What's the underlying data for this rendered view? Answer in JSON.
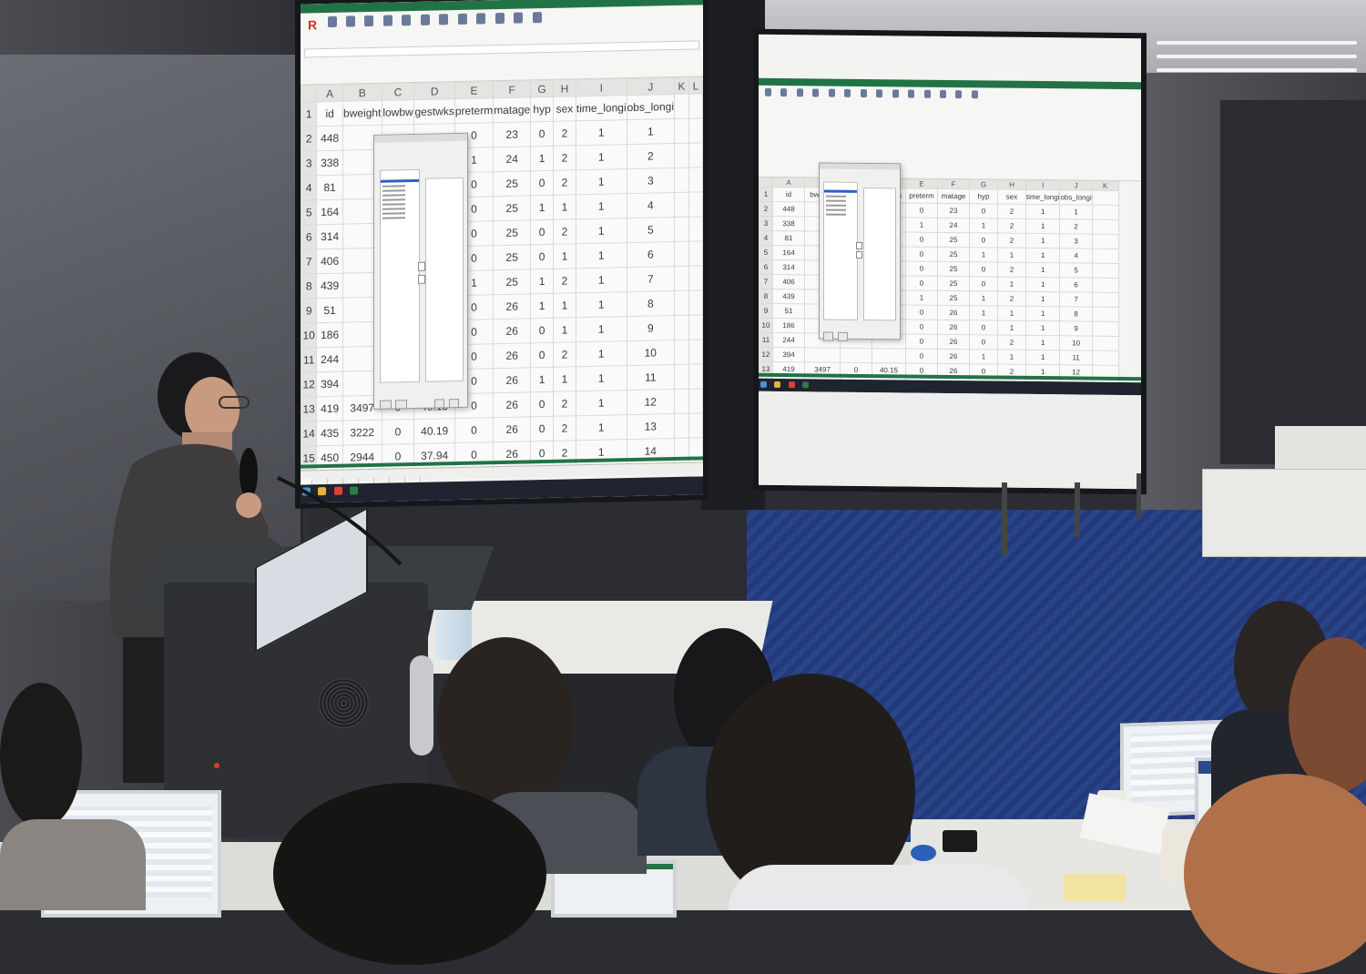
{
  "slide": {
    "app_logo": "R",
    "columns": [
      "A",
      "B",
      "C",
      "D",
      "E",
      "F",
      "G",
      "H",
      "I",
      "J",
      "K",
      "L"
    ],
    "headers": [
      "id",
      "bweight",
      "lowbw",
      "gestwks",
      "preterm",
      "matage",
      "hyp",
      "sex",
      "time_longi",
      "obs_longi"
    ],
    "rows": [
      {
        "n": "2",
        "id": "448",
        "bweight": "",
        "lowbw": "",
        "gestwks": "",
        "preterm": "0",
        "matage": "23",
        "hyp": "0",
        "sex": "2",
        "time": "1",
        "obs": "1"
      },
      {
        "n": "3",
        "id": "338",
        "bweight": "",
        "lowbw": "",
        "gestwks": "",
        "preterm": "1",
        "matage": "24",
        "hyp": "1",
        "sex": "2",
        "time": "1",
        "obs": "2"
      },
      {
        "n": "4",
        "id": "81",
        "bweight": "",
        "lowbw": "",
        "gestwks": "",
        "preterm": "0",
        "matage": "25",
        "hyp": "0",
        "sex": "2",
        "time": "1",
        "obs": "3"
      },
      {
        "n": "5",
        "id": "164",
        "bweight": "",
        "lowbw": "",
        "gestwks": "",
        "preterm": "0",
        "matage": "25",
        "hyp": "1",
        "sex": "1",
        "time": "1",
        "obs": "4"
      },
      {
        "n": "6",
        "id": "314",
        "bweight": "",
        "lowbw": "",
        "gestwks": "",
        "preterm": "0",
        "matage": "25",
        "hyp": "0",
        "sex": "2",
        "time": "1",
        "obs": "5"
      },
      {
        "n": "7",
        "id": "406",
        "bweight": "",
        "lowbw": "",
        "gestwks": "",
        "preterm": "0",
        "matage": "25",
        "hyp": "0",
        "sex": "1",
        "time": "1",
        "obs": "6"
      },
      {
        "n": "8",
        "id": "439",
        "bweight": "",
        "lowbw": "",
        "gestwks": "",
        "preterm": "1",
        "matage": "25",
        "hyp": "1",
        "sex": "2",
        "time": "1",
        "obs": "7"
      },
      {
        "n": "9",
        "id": "51",
        "bweight": "",
        "lowbw": "",
        "gestwks": "",
        "preterm": "0",
        "matage": "26",
        "hyp": "1",
        "sex": "1",
        "time": "1",
        "obs": "8"
      },
      {
        "n": "10",
        "id": "186",
        "bweight": "",
        "lowbw": "",
        "gestwks": "",
        "preterm": "0",
        "matage": "26",
        "hyp": "0",
        "sex": "1",
        "time": "1",
        "obs": "9"
      },
      {
        "n": "11",
        "id": "244",
        "bweight": "",
        "lowbw": "",
        "gestwks": "",
        "preterm": "0",
        "matage": "26",
        "hyp": "0",
        "sex": "2",
        "time": "1",
        "obs": "10"
      },
      {
        "n": "12",
        "id": "394",
        "bweight": "",
        "lowbw": "",
        "gestwks": "",
        "preterm": "0",
        "matage": "26",
        "hyp": "1",
        "sex": "1",
        "time": "1",
        "obs": "11"
      },
      {
        "n": "13",
        "id": "419",
        "bweight": "3497",
        "lowbw": "0",
        "gestwks": "40.15",
        "preterm": "0",
        "matage": "26",
        "hyp": "0",
        "sex": "2",
        "time": "1",
        "obs": "12"
      },
      {
        "n": "14",
        "id": "435",
        "bweight": "3222",
        "lowbw": "0",
        "gestwks": "40.19",
        "preterm": "0",
        "matage": "26",
        "hyp": "0",
        "sex": "2",
        "time": "1",
        "obs": "13"
      },
      {
        "n": "15",
        "id": "450",
        "bweight": "2944",
        "lowbw": "0",
        "gestwks": "37.94",
        "preterm": "0",
        "matage": "26",
        "hyp": "0",
        "sex": "2",
        "time": "1",
        "obs": "14"
      }
    ]
  },
  "colors": {
    "excel_green": "#217346",
    "selection_blue": "#2d5ec9",
    "carpet": "#233a7a"
  }
}
